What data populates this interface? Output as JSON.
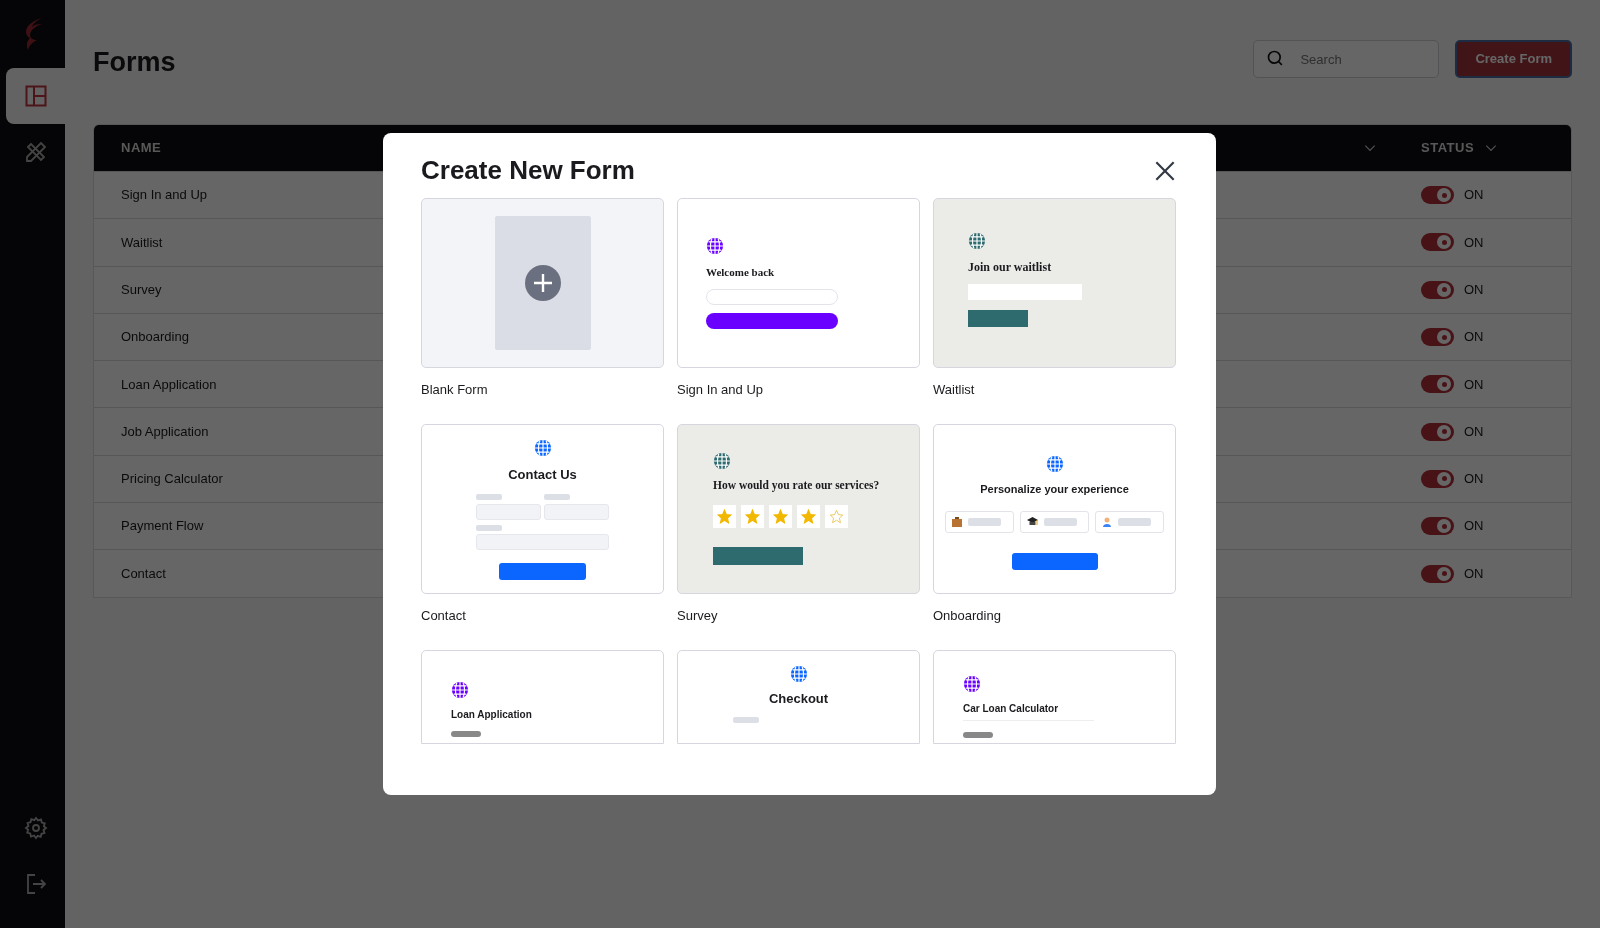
{
  "sidebar": {
    "nav": [
      {
        "kind": "dashboard",
        "selected": true
      },
      {
        "kind": "tools",
        "selected": false
      }
    ],
    "bottom": [
      {
        "kind": "settings"
      },
      {
        "kind": "logout"
      }
    ]
  },
  "page": {
    "title": "Forms",
    "search": {
      "placeholder": "Search"
    },
    "create_button": "Create Form"
  },
  "table": {
    "columns": {
      "name": "NAME",
      "status": "STATUS"
    },
    "rows": [
      {
        "name": "Sign In and Up",
        "on": true,
        "status": "ON"
      },
      {
        "name": "Waitlist",
        "on": true,
        "status": "ON"
      },
      {
        "name": "Survey",
        "on": true,
        "status": "ON"
      },
      {
        "name": "Onboarding",
        "on": true,
        "status": "ON"
      },
      {
        "name": "Loan Application",
        "on": true,
        "status": "ON"
      },
      {
        "name": "Job Application",
        "on": true,
        "status": "ON"
      },
      {
        "name": "Pricing Calculator",
        "on": true,
        "status": "ON"
      },
      {
        "name": "Payment Flow",
        "on": true,
        "status": "ON"
      },
      {
        "name": "Contact",
        "on": true,
        "status": "ON"
      }
    ]
  },
  "modal": {
    "title": "Create New Form",
    "templates": [
      {
        "kind": "blank",
        "label": "Blank Form"
      },
      {
        "kind": "signin",
        "label": "Sign In and Up",
        "heading": "Welcome back"
      },
      {
        "kind": "waitlist",
        "label": "Waitlist",
        "heading": "Join our waitlist"
      },
      {
        "kind": "contact",
        "label": "Contact",
        "heading": "Contact Us"
      },
      {
        "kind": "survey",
        "label": "Survey",
        "heading": "How would you rate our services?",
        "stars": 4
      },
      {
        "kind": "onboarding",
        "label": "Onboarding",
        "heading": "Personalize your experience"
      },
      {
        "kind": "loan",
        "heading": "Loan Application"
      },
      {
        "kind": "checkout",
        "heading": "Checkout"
      },
      {
        "kind": "carloan",
        "heading": "Car Loan Calculator"
      }
    ]
  }
}
